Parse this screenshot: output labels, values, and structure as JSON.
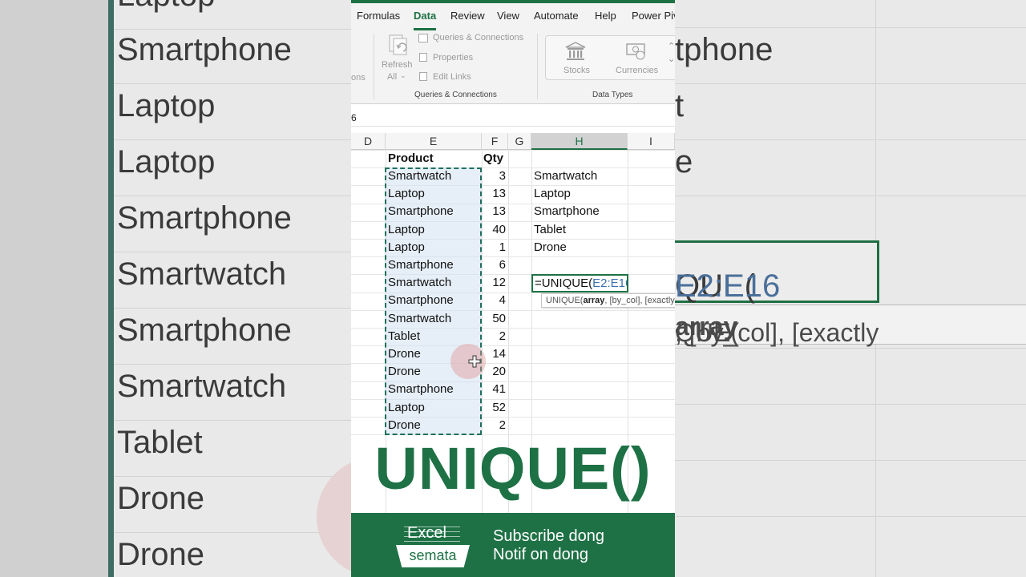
{
  "menu": {
    "tabs": [
      "Formulas",
      "Data",
      "Review",
      "View",
      "Automate",
      "Help",
      "Power Piv"
    ],
    "active": "Data"
  },
  "ribbon": {
    "clipped_label": "ons",
    "refresh_label_1": "Refresh",
    "refresh_label_2": "All",
    "queries_connections": "Queries & Connections",
    "properties": "Properties",
    "edit_links": "Edit Links",
    "group_queries": "Queries & Connections",
    "stocks": "Stocks",
    "currencies": "Currencies",
    "group_datatypes": "Data Types"
  },
  "formula_bar": {
    "text": "6"
  },
  "columns": [
    "D",
    "E",
    "F",
    "G",
    "H",
    "I"
  ],
  "selected_column": "H",
  "table": {
    "header_product": "Product",
    "header_qty": "Qty",
    "rows": [
      {
        "product": "Smartwatch",
        "qty": "3"
      },
      {
        "product": "Laptop",
        "qty": "13"
      },
      {
        "product": "Smartphone",
        "qty": "13"
      },
      {
        "product": "Laptop",
        "qty": "40"
      },
      {
        "product": "Laptop",
        "qty": "1"
      },
      {
        "product": "Smartphone",
        "qty": "6"
      },
      {
        "product": "Smartwatch",
        "qty": "12"
      },
      {
        "product": "Smartphone",
        "qty": "4"
      },
      {
        "product": "Smartwatch",
        "qty": "50"
      },
      {
        "product": "Tablet",
        "qty": "2"
      },
      {
        "product": "Drone",
        "qty": "14"
      },
      {
        "product": "Drone",
        "qty": "20"
      },
      {
        "product": "Smartphone",
        "qty": "41"
      },
      {
        "product": "Laptop",
        "qty": "52"
      },
      {
        "product": "Drone",
        "qty": "2"
      }
    ]
  },
  "unique_results": [
    "Smartwatch",
    "Laptop",
    "Smartphone",
    "Tablet",
    "Drone"
  ],
  "edit_cell": {
    "prefix": "=UNIQUE(",
    "ref": "E2:E16"
  },
  "tooltip": {
    "fn": "UNIQUE(",
    "arg": "array",
    "rest": ", [by_col], [exactly"
  },
  "title": "UNIQUE()",
  "footer": {
    "logo_top": "Excel",
    "logo_bottom": "semata",
    "line1": "Subscribe dong",
    "line2": "Notif on dong"
  },
  "background": {
    "left_words": [
      "Laptop",
      "Smartphone",
      "Laptop",
      "Laptop",
      "Smartphone",
      "Smartwatch",
      "Smartphone",
      "Smartwatch",
      "Tablet",
      "Drone",
      "Drone"
    ],
    "right_words": [
      "tphone",
      "t",
      "e"
    ],
    "right_formula_prefix": "QUE(",
    "right_formula_ref": "E2:E16",
    "right_tip_prefix": "QUE(",
    "right_tip_arg": "array",
    "right_tip_rest": ", [by_col], [exactly"
  },
  "colors": {
    "excel_green": "#1e7145",
    "selection_fill": "#d2e1f0",
    "ref_blue": "#3a6fb0"
  }
}
